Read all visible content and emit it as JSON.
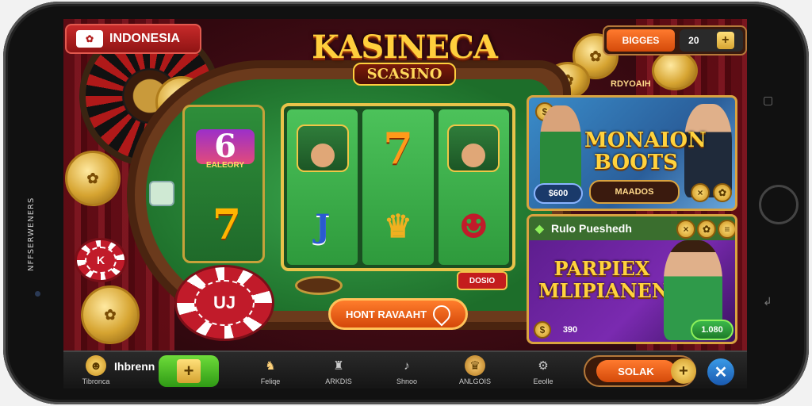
{
  "device": {
    "side_text": "NFFSERWENERS"
  },
  "header": {
    "region_badge": "INDONESIA",
    "logo_title": "KASINECA",
    "logo_subtitle": "SCASINO",
    "currency_pill": "BIGGES",
    "balance": "20",
    "top_label": "RDYOAIH"
  },
  "table": {
    "left_reel_six_caption": "EALEORY",
    "bonus_tag": "DOSIO",
    "spin_button": "HONT RAVAAHT",
    "chip_left_label": "K",
    "chip_big_label": "UJ"
  },
  "promo1": {
    "title_line1": "MONAION",
    "title_line2": "BOOTS",
    "price": "$600",
    "button": "MAADOS"
  },
  "promo2": {
    "header": "Rulo Pueshedh",
    "title_line1": "PARPIEX",
    "title_line2": "MLIPIANEN",
    "left_amount": "390",
    "right_amount": "1.080"
  },
  "bottom_bar": {
    "profile_label": "Tibronca",
    "user_text": "Ihbrenn Ing",
    "nav_items": [
      {
        "label": "Feliqe",
        "icon": "dog-icon"
      },
      {
        "label": "ARKDIS",
        "icon": "bottle-icon"
      },
      {
        "label": "Shnoo",
        "icon": "whistle-icon"
      },
      {
        "label": "ANLGOIS",
        "icon": "lion-icon"
      },
      {
        "label": "Eeolle",
        "icon": "gear-icon"
      }
    ],
    "cta_button": "SOLAK"
  },
  "colors": {
    "accent_gold": "#ffcf3d",
    "accent_orange": "#d44a0a",
    "felt_green": "#2e9a3c",
    "brand_red": "#b01919"
  }
}
